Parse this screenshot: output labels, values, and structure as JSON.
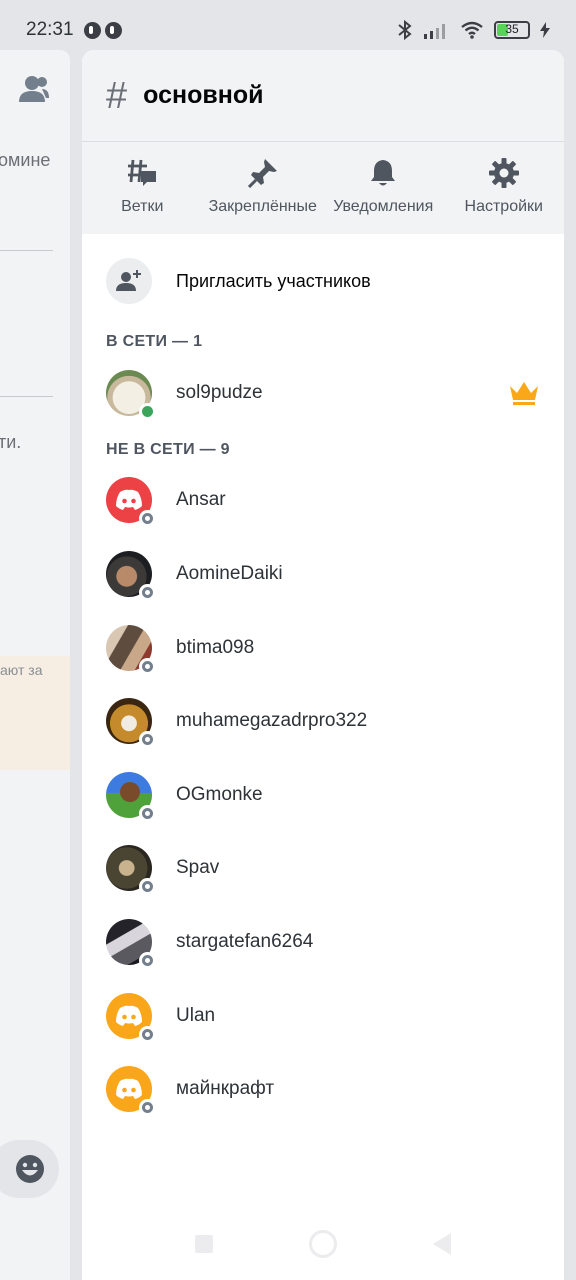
{
  "status_bar": {
    "time": "22:31",
    "battery": "35"
  },
  "left_pane": {
    "fragments": [
      "омине",
      "ти.",
      "ают за"
    ]
  },
  "channel": {
    "hash": "#",
    "name": "основной"
  },
  "toolbar": [
    {
      "id": "threads",
      "label": "Ветки",
      "icon": "threads-icon"
    },
    {
      "id": "pins",
      "label": "Закреплённые",
      "icon": "pin-icon"
    },
    {
      "id": "notifications",
      "label": "Уведомления",
      "icon": "bell-icon"
    },
    {
      "id": "settings",
      "label": "Настройки",
      "icon": "gear-icon"
    }
  ],
  "invite": {
    "label": "Пригласить участников",
    "icon": "add-user-icon"
  },
  "online": {
    "header": "В СЕТИ — 1",
    "members": [
      {
        "name": "sol9pudze",
        "status": "online",
        "owner": true
      }
    ]
  },
  "offline": {
    "header": "НЕ В СЕТИ — 9",
    "members": [
      {
        "name": "Ansar",
        "avatar": "discord-red"
      },
      {
        "name": "AomineDaiki",
        "avatar": "photo"
      },
      {
        "name": "btima098",
        "avatar": "photo"
      },
      {
        "name": "muhamegazadrpro322",
        "avatar": "photo"
      },
      {
        "name": "OGmonke",
        "avatar": "photo"
      },
      {
        "name": "Spav",
        "avatar": "photo"
      },
      {
        "name": "stargatefan6264",
        "avatar": "photo"
      },
      {
        "name": "Ulan",
        "avatar": "discord-yellow"
      },
      {
        "name": "майнкрафт",
        "avatar": "discord-yellow"
      }
    ]
  },
  "colors": {
    "online": "#3ba55c",
    "offline": "#747f8d",
    "crown": "#faa81a",
    "discord_red": "#ed4245",
    "discord_yellow": "#faa61a"
  }
}
